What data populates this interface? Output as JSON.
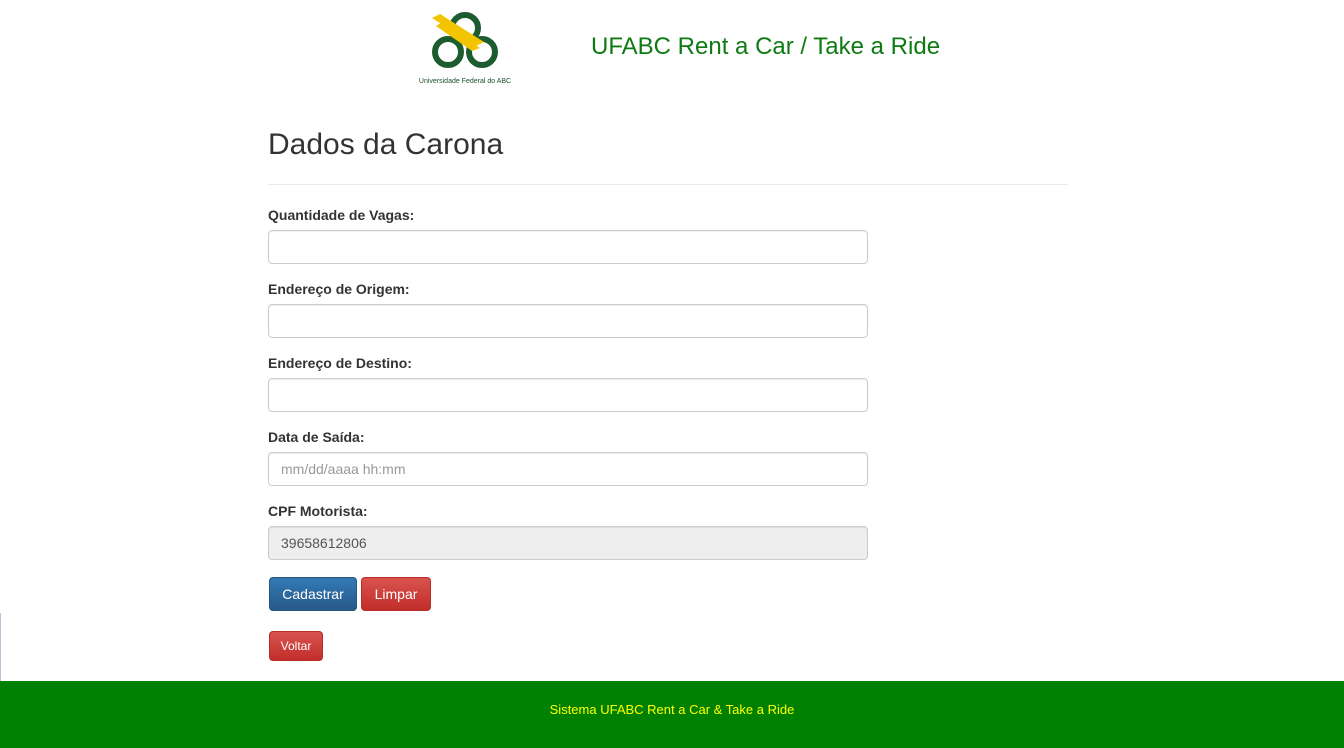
{
  "header": {
    "logo_text": "Universidade Federal do ABC",
    "site_title": "UFABC Rent a Car / Take a Ride"
  },
  "page": {
    "title": "Dados da Carona"
  },
  "form": {
    "vagas_label": "Quantidade de Vagas:",
    "vagas_value": "",
    "origem_label": "Endereço de Origem:",
    "origem_value": "",
    "destino_label": "Endereço de Destino:",
    "destino_value": "",
    "data_label": "Data de Saída:",
    "data_placeholder": "mm/dd/aaaa hh:mm",
    "data_value": "",
    "cpf_label": "CPF Motorista:",
    "cpf_value": "39658612806"
  },
  "actions": {
    "cadastrar_label": "Cadastrar",
    "limpar_label": "Limpar",
    "voltar_label": "Voltar"
  },
  "footer": {
    "text": "Sistema UFABC Rent a Car & Take a Ride"
  },
  "colors": {
    "brand_green": "#008000",
    "title_green": "#0f7a14",
    "footer_text": "#ffff00",
    "primary": "#337ab7",
    "danger": "#d9534f",
    "logo_yellow": "#f2c500",
    "logo_green": "#1d5c2f"
  }
}
